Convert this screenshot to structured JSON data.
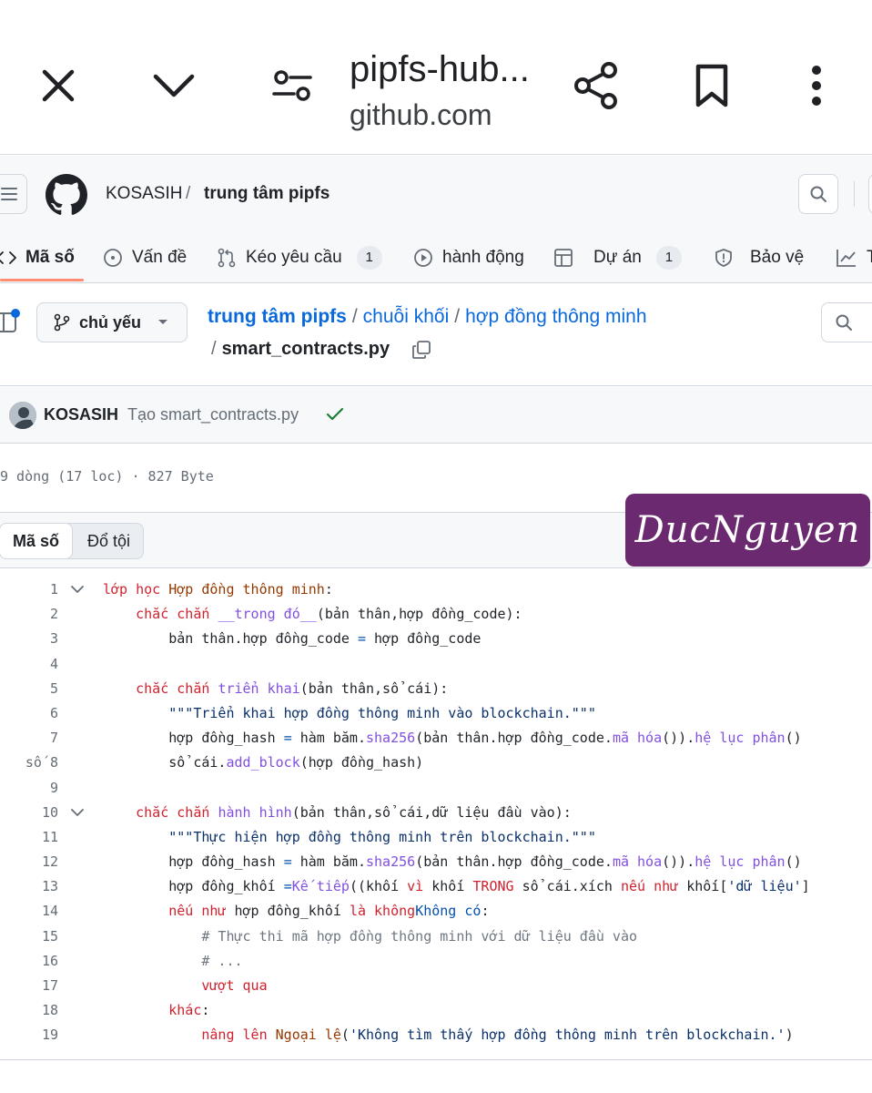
{
  "browser": {
    "title": "pipfs-hub...",
    "url": "github.com"
  },
  "header": {
    "owner": "KOSASIH",
    "separator": "/",
    "repo": "trung tâm pipfs"
  },
  "tabs": [
    {
      "label": "Mã số",
      "icon": "code-icon"
    },
    {
      "label": "Vấn đề",
      "icon": "issue-icon"
    },
    {
      "label": "Kéo yêu cầu",
      "icon": "pull-request-icon",
      "count": "1"
    },
    {
      "label": "hành động",
      "icon": "play-icon"
    },
    {
      "label": "Dự án",
      "icon": "table-icon",
      "count": "1"
    },
    {
      "label": "Bảo vệ",
      "icon": "shield-icon"
    },
    {
      "label": "T",
      "icon": "graph-icon"
    }
  ],
  "file_nav": {
    "branch": "chủ yếu",
    "path": [
      "trung tâm pipfs",
      "chuỗi khối",
      "hợp đồng thông minh"
    ],
    "path_sep": "/",
    "file_name": "smart_contracts.py"
  },
  "commit": {
    "author": "KOSASIH",
    "message": "Tạo smart_contracts.py"
  },
  "file_info": "9 dòng (17 loc) · 827 Byte",
  "code_header": {
    "tab_code": "Mã số",
    "tab_blame": "Đổ tội"
  },
  "watermark": "DucNguyen",
  "code_lines": [
    {
      "n": "1",
      "fold": true,
      "parts": [
        [
          "kw",
          "lớp học "
        ],
        [
          "cls",
          "Hợp đồng thông minh"
        ],
        [
          "",
          ":"
        ]
      ]
    },
    {
      "n": "2",
      "parts": [
        [
          "",
          "    "
        ],
        [
          "kw",
          "chắc chắn "
        ],
        [
          "fn",
          "__trong đó__"
        ],
        [
          "",
          "(bản thân,hợp đồng_code):"
        ]
      ]
    },
    {
      "n": "3",
      "parts": [
        [
          "",
          "        bản thân.hợp đồng_code "
        ],
        [
          "op",
          "="
        ],
        [
          "",
          " hợp đồng_code"
        ]
      ]
    },
    {
      "n": "4",
      "parts": [
        [
          "",
          ""
        ]
      ]
    },
    {
      "n": "5",
      "parts": [
        [
          "",
          "    "
        ],
        [
          "kw",
          "chắc chắn "
        ],
        [
          "fn",
          "triển khai"
        ],
        [
          "",
          "(bản thân,sổ cái):"
        ]
      ]
    },
    {
      "n": "6",
      "parts": [
        [
          "",
          "        "
        ],
        [
          "str",
          "\"\"\"Triển khai hợp đồng thông minh vào blockchain.\"\"\""
        ]
      ]
    },
    {
      "n": "7",
      "parts": [
        [
          "",
          "        hợp đồng_hash "
        ],
        [
          "op",
          "="
        ],
        [
          "",
          " hàm băm."
        ],
        [
          "fn",
          "sha256"
        ],
        [
          "",
          "(bản thân.hợp đồng_code."
        ],
        [
          "fn",
          "mã hóa"
        ],
        [
          "",
          "())."
        ],
        [
          "fn",
          "hệ lục phân"
        ],
        [
          "",
          "()"
        ]
      ]
    },
    {
      "n": "8",
      "prefix": "số",
      "parts": [
        [
          "",
          "        sổ cái."
        ],
        [
          "fn",
          "add_block"
        ],
        [
          "",
          "(hợp đồng_hash)"
        ]
      ]
    },
    {
      "n": "9",
      "parts": [
        [
          "",
          ""
        ]
      ]
    },
    {
      "n": "10",
      "fold": true,
      "parts": [
        [
          "",
          "    "
        ],
        [
          "kw",
          "chắc chắn "
        ],
        [
          "fn",
          "hành hình"
        ],
        [
          "",
          "(bản thân,sổ cái,dữ liệu đầu vào):"
        ]
      ]
    },
    {
      "n": "11",
      "parts": [
        [
          "",
          "        "
        ],
        [
          "str",
          "\"\"\"Thực hiện hợp đồng thông minh trên blockchain.\"\"\""
        ]
      ]
    },
    {
      "n": "12",
      "parts": [
        [
          "",
          "        hợp đồng_hash "
        ],
        [
          "op",
          "="
        ],
        [
          "",
          " hàm băm."
        ],
        [
          "fn",
          "sha256"
        ],
        [
          "",
          "(bản thân.hợp đồng_code."
        ],
        [
          "fn",
          "mã hóa"
        ],
        [
          "",
          "())."
        ],
        [
          "fn",
          "hệ lục phân"
        ],
        [
          "",
          "()"
        ]
      ]
    },
    {
      "n": "13",
      "parts": [
        [
          "",
          "        hợp đồng_khối "
        ],
        [
          "op",
          "="
        ],
        [
          " ",
          ""
        ],
        [
          "fn",
          "Kế tiếp"
        ],
        [
          "",
          "((khối "
        ],
        [
          "kw",
          "vì"
        ],
        [
          "",
          " khối "
        ],
        [
          "kw",
          "TRONG"
        ],
        [
          "",
          " sổ cái.xích "
        ],
        [
          "kw",
          "nếu như"
        ],
        [
          "",
          " khối["
        ],
        [
          "str",
          "'dữ liệu'"
        ],
        [
          "",
          "]"
        ]
      ]
    },
    {
      "n": "14",
      "parts": [
        [
          "",
          "        "
        ],
        [
          "kw",
          "nếu như"
        ],
        [
          "",
          " hợp đồng_khối "
        ],
        [
          "kw",
          "là không"
        ],
        [
          " ",
          ""
        ],
        [
          "op",
          "Không có"
        ],
        [
          "",
          ":"
        ]
      ]
    },
    {
      "n": "15",
      "parts": [
        [
          "",
          "            "
        ],
        [
          "cm",
          "# Thực thi mã hợp đồng thông minh với dữ liệu đầu vào"
        ]
      ]
    },
    {
      "n": "16",
      "parts": [
        [
          "",
          "            "
        ],
        [
          "cm",
          "# ..."
        ]
      ]
    },
    {
      "n": "17",
      "parts": [
        [
          "",
          "            "
        ],
        [
          "kw",
          "vượt qua"
        ]
      ]
    },
    {
      "n": "18",
      "parts": [
        [
          "",
          "        "
        ],
        [
          "kw",
          "khác"
        ],
        [
          "",
          ":"
        ]
      ]
    },
    {
      "n": "19",
      "parts": [
        [
          "",
          "            "
        ],
        [
          "kw",
          "nâng lên "
        ],
        [
          "cls",
          "Ngoại lệ"
        ],
        [
          "",
          "("
        ],
        [
          "str",
          "'Không tìm thấy hợp đồng thông minh trên blockchain.'"
        ],
        [
          "",
          ")"
        ]
      ]
    }
  ]
}
